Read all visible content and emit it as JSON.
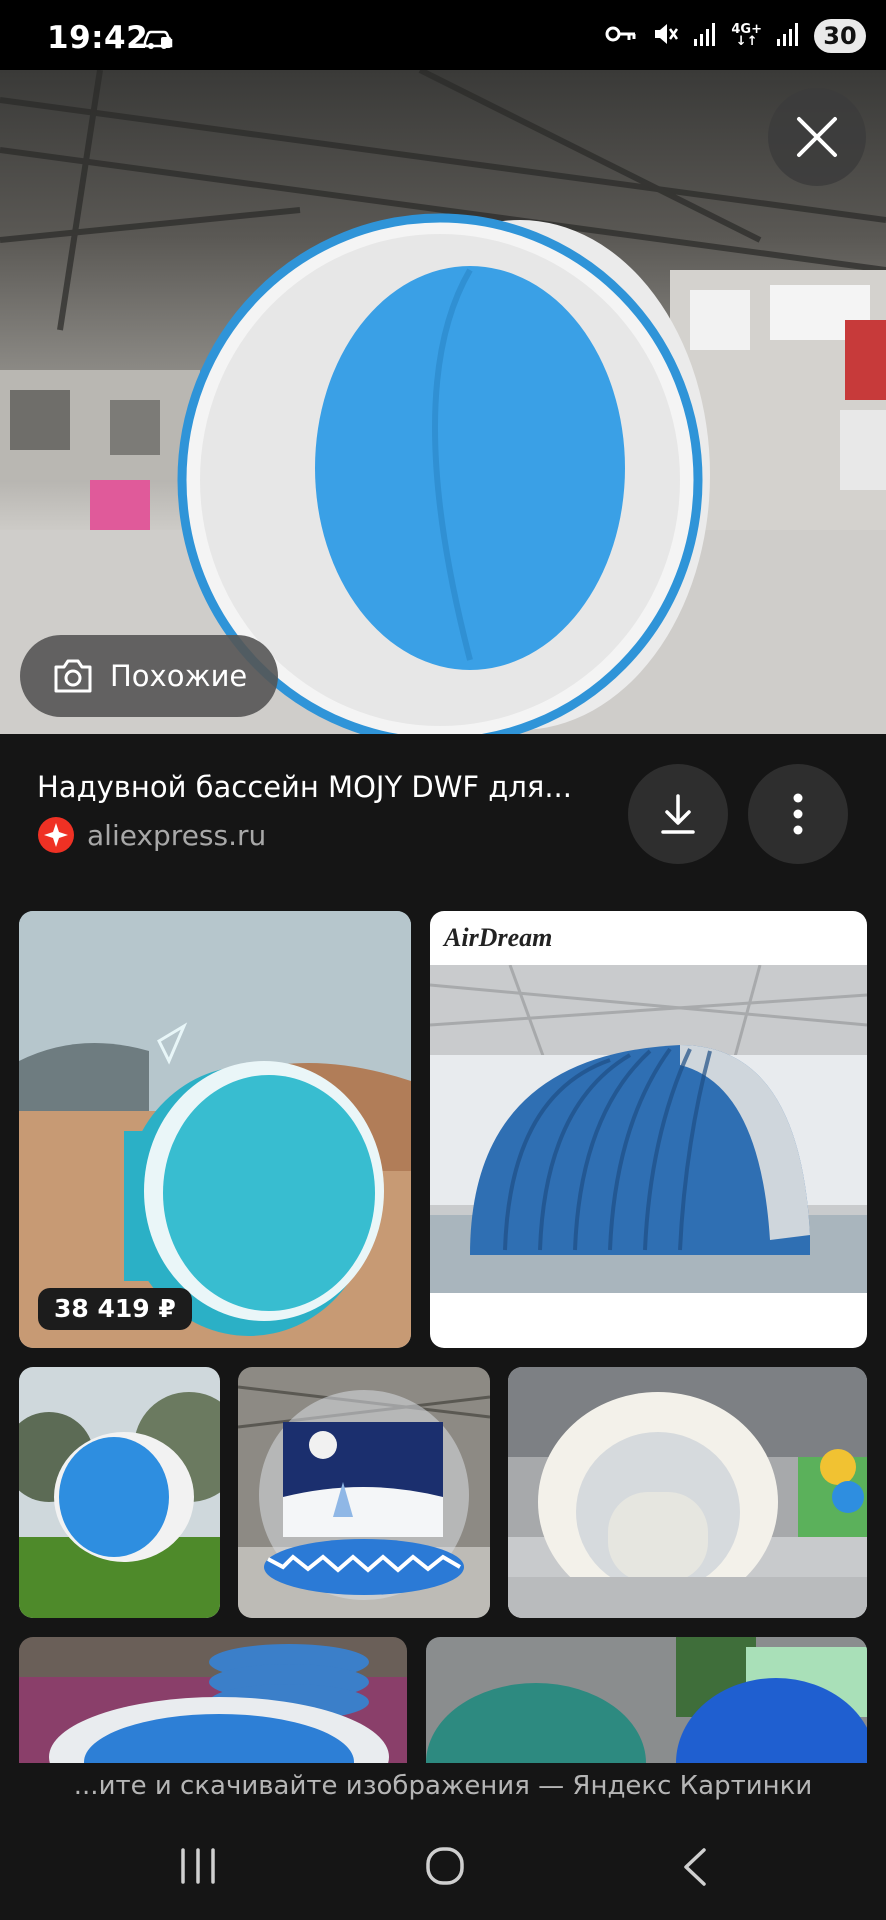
{
  "status_bar": {
    "time": "19:42",
    "network_label": "4G+",
    "battery": "30",
    "icons": [
      "car-icon",
      "key-icon",
      "mute-icon",
      "signal-icon",
      "signal-icon"
    ]
  },
  "viewer": {
    "close_icon": "close-icon",
    "similar_label": "Похожие",
    "similar_icon": "camera-lens-icon"
  },
  "image_info": {
    "title": "Надувной бассейн MOJY DWF для...",
    "source": "aliexpress.ru",
    "source_icon": "aliexpress-logo-icon",
    "download_icon": "download-icon",
    "more_icon": "more-vertical-icon"
  },
  "results": {
    "price": "38 419 ₽",
    "brand_text": "AirDream",
    "tiles": [
      "teal-round-pool-desert",
      "airdream-inflatable-tunnel",
      "round-pool-on-grass",
      "inflatable-snow-globe",
      "white-bubble-tent",
      "stacked-inflatable-pools",
      "green-and-blue-pools"
    ]
  },
  "footer": {
    "text": "...ите и скачивайте изображения — Яндекс Картинки"
  },
  "nav": {
    "recents_icon": "recents-icon",
    "home_icon": "home-icon",
    "back_icon": "back-icon"
  },
  "colors": {
    "background": "#151515",
    "pool_blue": "#3aa0e6",
    "teal": "#34b4c8",
    "source_red": "#ef3124"
  }
}
